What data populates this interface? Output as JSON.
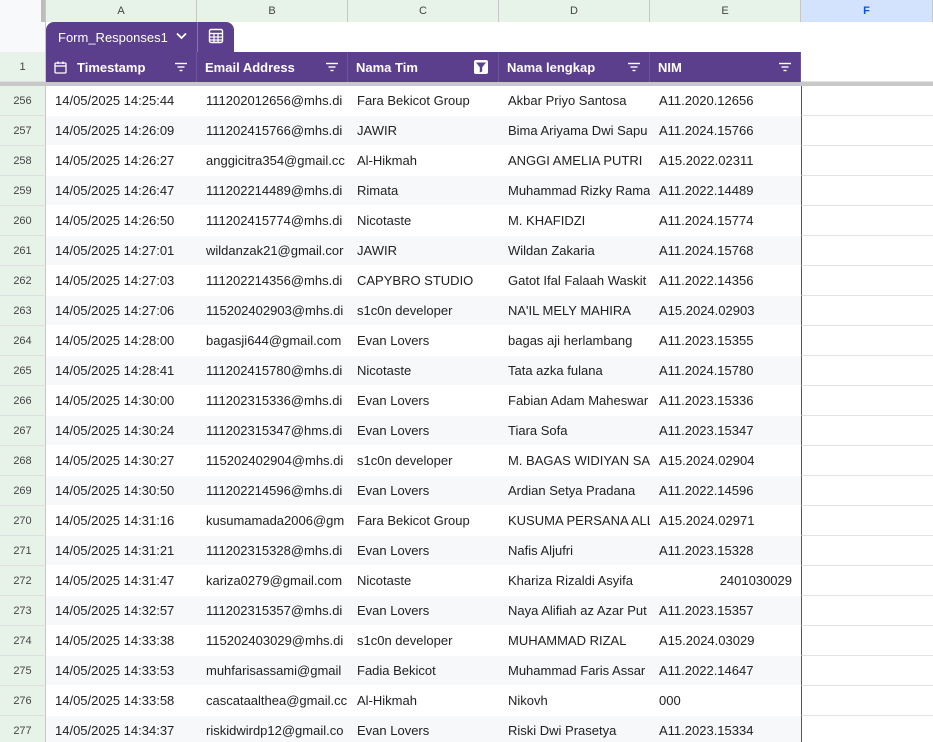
{
  "columns": [
    "A",
    "B",
    "C",
    "D",
    "E",
    "F"
  ],
  "table": {
    "name": "Form_Responses1"
  },
  "header_row_number": "1",
  "headers": [
    "Timestamp",
    "Email Address",
    "Nama Tim",
    "Nama lengkap",
    "NIM"
  ],
  "rows": [
    {
      "n": "256",
      "a": "14/05/2025 14:25:44",
      "b": "111202012656@mhs.di",
      "c": "Fara Bekicot Group",
      "d": "Akbar Priyo Santosa",
      "e": "A11.2020.12656"
    },
    {
      "n": "257",
      "a": "14/05/2025 14:26:09",
      "b": "111202415766@mhs.di",
      "c": "JAWIR",
      "d": "Bima Ariyama Dwi Sapu",
      "e": "A11.2024.15766"
    },
    {
      "n": "258",
      "a": "14/05/2025 14:26:27",
      "b": "anggicitra354@gmail.cc",
      "c": "Al-Hikmah",
      "d": "ANGGI AMELIA PUTRI",
      "e": "A15.2022.02311"
    },
    {
      "n": "259",
      "a": "14/05/2025 14:26:47",
      "b": "111202214489@mhs.di",
      "c": "Rimata",
      "d": "Muhammad Rizky Rama",
      "e": "A11.2022.14489"
    },
    {
      "n": "260",
      "a": "14/05/2025 14:26:50",
      "b": "111202415774@mhs.di",
      "c": "Nicotaste",
      "d": "M. KHAFIDZI",
      "e": "A11.2024.15774"
    },
    {
      "n": "261",
      "a": "14/05/2025 14:27:01",
      "b": "wildanzak21@gmail.cor",
      "c": "JAWIR",
      "d": "Wildan Zakaria",
      "e": "A11.2024.15768"
    },
    {
      "n": "262",
      "a": "14/05/2025 14:27:03",
      "b": "111202214356@mhs.di",
      "c": "CAPYBRO STUDIO",
      "d": "Gatot Ifal Falaah Waskit",
      "e": "A11.2022.14356"
    },
    {
      "n": "263",
      "a": "14/05/2025 14:27:06",
      "b": "115202402903@mhs.di",
      "c": "s1c0n developer",
      "d": "NA'IL MELY MAHIRA",
      "e": "A15.2024.02903"
    },
    {
      "n": "264",
      "a": "14/05/2025 14:28:00",
      "b": "bagasji644@gmail.com",
      "c": "Evan Lovers",
      "d": "bagas aji herlambang",
      "e": "A11.2023.15355"
    },
    {
      "n": "265",
      "a": "14/05/2025 14:28:41",
      "b": "111202415780@mhs.di",
      "c": "Nicotaste",
      "d": "Tata azka fulana",
      "e": "A11.2024.15780"
    },
    {
      "n": "266",
      "a": "14/05/2025 14:30:00",
      "b": "111202315336@mhs.di",
      "c": "Evan Lovers",
      "d": "Fabian Adam Maheswar",
      "e": "A11.2023.15336"
    },
    {
      "n": "267",
      "a": "14/05/2025 14:30:24",
      "b": "111202315347@hms.di",
      "c": "Evan Lovers",
      "d": "Tiara Sofa",
      "e": "A11.2023.15347"
    },
    {
      "n": "268",
      "a": "14/05/2025 14:30:27",
      "b": "115202402904@mhs.di",
      "c": "s1c0n developer",
      "d": "M. BAGAS WIDIYAN SAF",
      "e": "A15.2024.02904"
    },
    {
      "n": "269",
      "a": "14/05/2025 14:30:50",
      "b": "111202214596@mhs.di",
      "c": "Evan Lovers",
      "d": "Ardian Setya Pradana",
      "e": "A11.2022.14596"
    },
    {
      "n": "270",
      "a": "14/05/2025 14:31:16",
      "b": "kusumamada2006@gm",
      "c": "Fara Bekicot Group",
      "d": "KUSUMA PERSANA ALL",
      "e": "A15.2024.02971"
    },
    {
      "n": "271",
      "a": "14/05/2025 14:31:21",
      "b": "111202315328@mhs.di",
      "c": "Evan Lovers",
      "d": "Nafis Aljufri",
      "e": "A11.2023.15328"
    },
    {
      "n": "272",
      "a": "14/05/2025 14:31:47",
      "b": "kariza0279@gmail.com",
      "c": "Nicotaste",
      "d": "Khariza Rizaldi Asyifa",
      "e": "2401030029",
      "e_right": true
    },
    {
      "n": "273",
      "a": "14/05/2025 14:32:57",
      "b": "111202315357@mhs.di",
      "c": "Evan Lovers",
      "d": "Naya Alifiah az Azar Put",
      "e": "A11.2023.15357"
    },
    {
      "n": "274",
      "a": "14/05/2025 14:33:38",
      "b": "115202403029@mhs.di",
      "c": "s1c0n developer",
      "d": "MUHAMMAD RIZAL",
      "e": "A15.2024.03029"
    },
    {
      "n": "275",
      "a": "14/05/2025 14:33:53",
      "b": "muhfarisassami@gmail",
      "c": "Fadia Bekicot",
      "d": "Muhammad Faris Assar",
      "e": "A11.2022.14647"
    },
    {
      "n": "276",
      "a": "14/05/2025 14:33:58",
      "b": "cascataalthea@gmail.cc",
      "c": "Al-Hikmah",
      "d": "Nikovh",
      "e": "000"
    },
    {
      "n": "277",
      "a": "14/05/2025 14:34:37",
      "b": "riskidwirdp12@gmail.co",
      "c": "Evan Lovers",
      "d": "Riski Dwi Prasetya",
      "e": "A11.2023.15334"
    }
  ]
}
